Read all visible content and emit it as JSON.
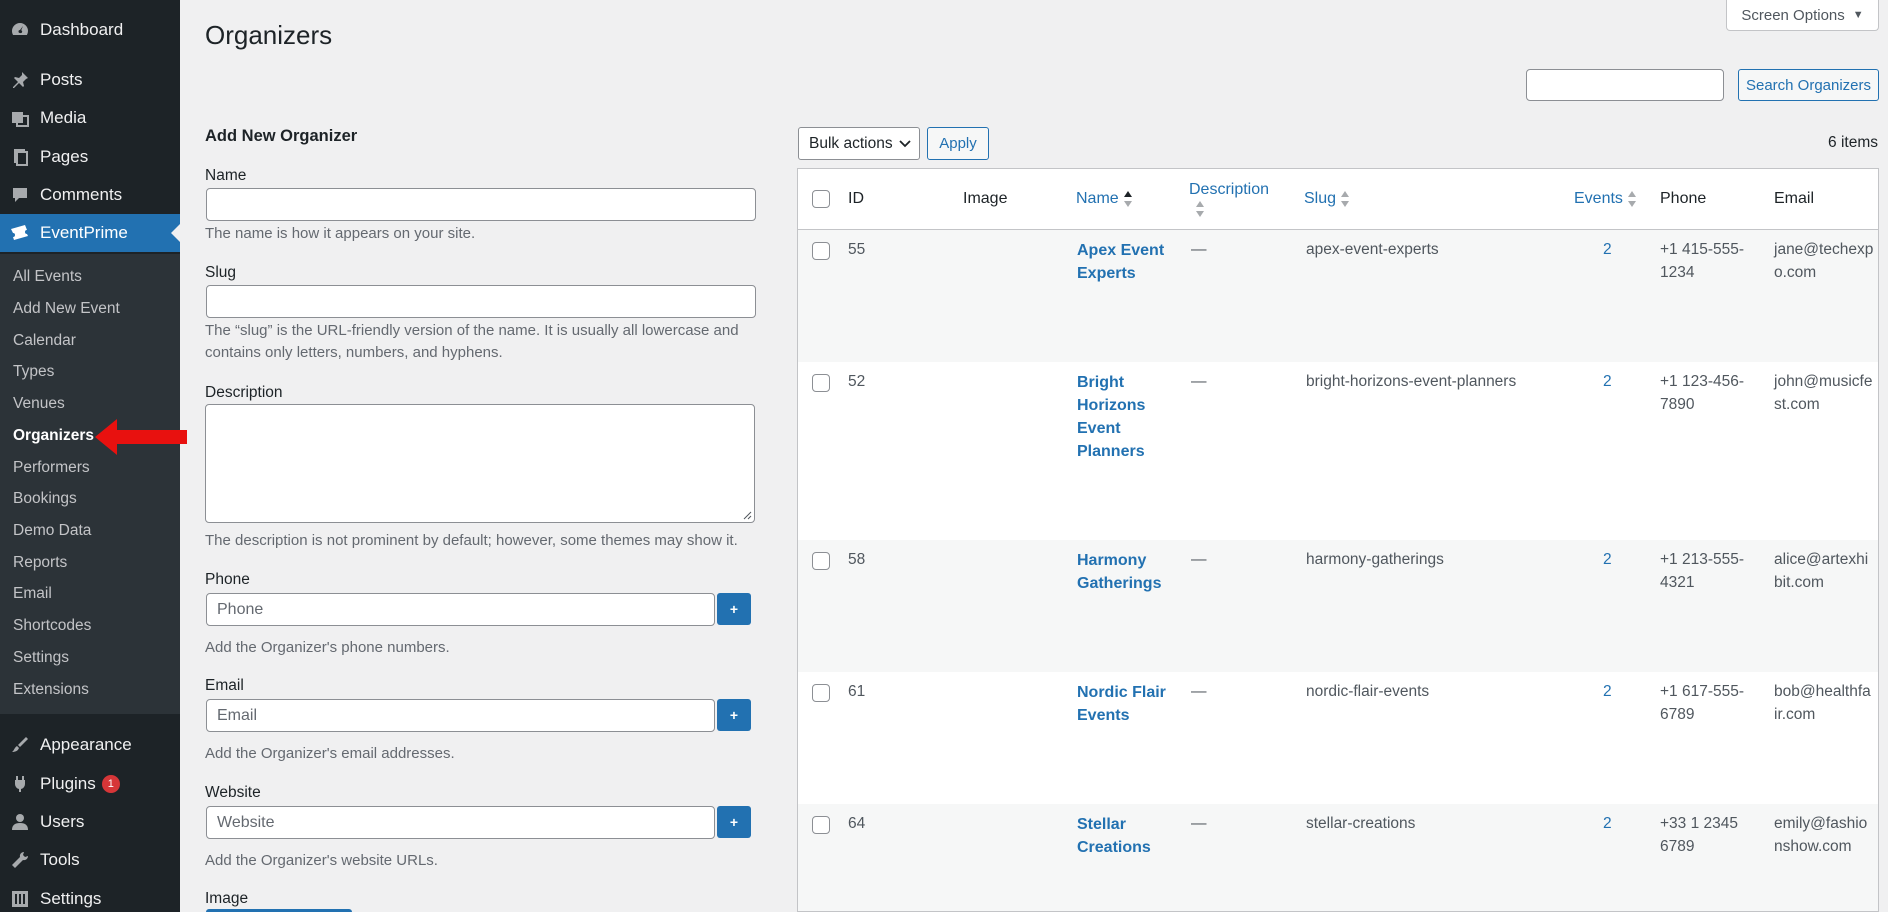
{
  "sidebar": {
    "top_items": [
      {
        "label": "Dashboard",
        "icon": "dashboard-icon"
      },
      {
        "label": "Posts",
        "icon": "pin-icon"
      },
      {
        "label": "Media",
        "icon": "media-icon"
      },
      {
        "label": "Pages",
        "icon": "pages-icon"
      },
      {
        "label": "Comments",
        "icon": "comments-icon"
      },
      {
        "label": "EventPrime",
        "icon": "tickets-icon"
      }
    ],
    "submenu": [
      "All Events",
      "Add New Event",
      "Calendar",
      "Types",
      "Venues",
      "Organizers",
      "Performers",
      "Bookings",
      "Demo Data",
      "Reports",
      "Email",
      "Shortcodes",
      "Settings",
      "Extensions"
    ],
    "current_submenu": "Organizers",
    "bottom_items": [
      {
        "label": "Appearance",
        "icon": "brush-icon"
      },
      {
        "label": "Plugins",
        "icon": "plugins-icon",
        "badge": "1"
      },
      {
        "label": "Users",
        "icon": "users-icon"
      },
      {
        "label": "Tools",
        "icon": "tools-icon"
      },
      {
        "label": "Settings",
        "icon": "settings-icon"
      }
    ]
  },
  "header": {
    "title": "Organizers",
    "screen_options": "Screen Options",
    "search_button": "Search Organizers",
    "search_value": ""
  },
  "form": {
    "title": "Add New Organizer",
    "name_label": "Name",
    "name_help": "The name is how it appears on your site.",
    "slug_label": "Slug",
    "slug_help_1": "The “slug” is the URL-friendly version of the name. It is usually all lowercase and",
    "slug_help_2": "contains only letters, numbers, and hyphens.",
    "description_label": "Description",
    "description_help": "The description is not prominent by default; however, some themes may show it.",
    "phone_label": "Phone",
    "phone_placeholder": "Phone",
    "phone_help": "Add the Organizer's phone numbers.",
    "email_label": "Email",
    "email_placeholder": "Email",
    "email_help": "Add the Organizer's email addresses.",
    "website_label": "Website",
    "website_placeholder": "Website",
    "website_help": "Add the Organizer's website URLs.",
    "image_label": "Image",
    "add_symbol": "+"
  },
  "table": {
    "bulk_actions": "Bulk actions",
    "apply": "Apply",
    "item_count": "6 items",
    "columns": {
      "id": "ID",
      "image": "Image",
      "name": "Name",
      "description": "Description",
      "slug": "Slug",
      "events": "Events",
      "phone": "Phone",
      "email": "Email"
    },
    "rows": [
      {
        "id": "55",
        "name": [
          "Apex Event",
          "Experts"
        ],
        "description": "—",
        "slug": "apex-event-experts",
        "events": "2",
        "phone": [
          "+1 415-555-",
          "1234"
        ],
        "email": [
          "jane@techexp",
          "o.com"
        ]
      },
      {
        "id": "52",
        "name": [
          "Bright",
          "Horizons",
          "Event",
          "Planners"
        ],
        "description": "—",
        "slug": "bright-horizons-event-planners",
        "events": "2",
        "phone": [
          "+1 123-456-",
          "7890"
        ],
        "email": [
          "john@musicfe",
          "st.com"
        ]
      },
      {
        "id": "58",
        "name": [
          "Harmony",
          "Gatherings"
        ],
        "description": "—",
        "slug": "harmony-gatherings",
        "events": "2",
        "phone": [
          "+1 213-555-",
          "4321"
        ],
        "email": [
          "alice@artexhi",
          "bit.com"
        ]
      },
      {
        "id": "61",
        "name": [
          "Nordic Flair",
          "Events"
        ],
        "description": "—",
        "slug": "nordic-flair-events",
        "events": "2",
        "phone": [
          "+1 617-555-",
          "6789"
        ],
        "email": [
          "bob@healthfa",
          "ir.com"
        ]
      },
      {
        "id": "64",
        "name": [
          "Stellar",
          "Creations"
        ],
        "description": "—",
        "slug": "stellar-creations",
        "events": "2",
        "phone": [
          "+33 1 2345",
          "6789"
        ],
        "email": [
          "emily@fashio",
          "nshow.com"
        ]
      }
    ]
  },
  "colors": {
    "accent": "#2271b1",
    "sidebar": "#1d2327",
    "submenu": "#2c3338",
    "arrow": "#e8110f",
    "badge": "#d63638"
  }
}
